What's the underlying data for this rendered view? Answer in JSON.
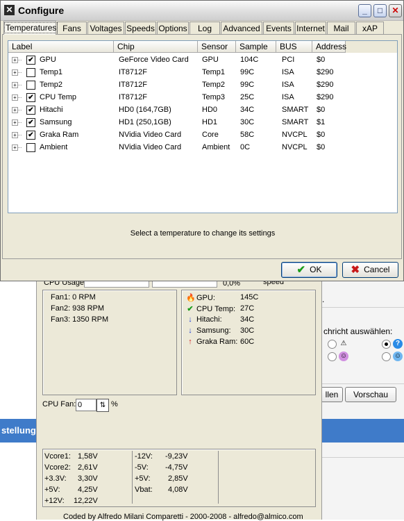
{
  "dialog": {
    "title": "Configure",
    "window_buttons": {
      "minimize": "_",
      "maximize": "□",
      "close": "✕"
    },
    "tabs": [
      {
        "label": "Temperatures",
        "active": true
      },
      {
        "label": "Fans"
      },
      {
        "label": "Voltages"
      },
      {
        "label": "Speeds"
      },
      {
        "label": "Options"
      },
      {
        "label": "Log"
      },
      {
        "label": "Advanced"
      },
      {
        "label": "Events"
      },
      {
        "label": "Internet"
      },
      {
        "label": "Mail"
      },
      {
        "label": "xAP"
      }
    ],
    "columns": [
      "Label",
      "Chip",
      "Sensor",
      "Sample",
      "BUS",
      "Address"
    ],
    "rows": [
      {
        "checked": true,
        "label": "GPU",
        "chip": "GeForce Video Card",
        "sensor": "GPU",
        "sample": "104C",
        "bus": "PCI",
        "address": "$0"
      },
      {
        "checked": false,
        "label": "Temp1",
        "chip": "IT8712F",
        "sensor": "Temp1",
        "sample": "99C",
        "bus": "ISA",
        "address": "$290"
      },
      {
        "checked": false,
        "label": "Temp2",
        "chip": "IT8712F",
        "sensor": "Temp2",
        "sample": "99C",
        "bus": "ISA",
        "address": "$290"
      },
      {
        "checked": true,
        "label": "CPU Temp",
        "chip": "IT8712F",
        "sensor": "Temp3",
        "sample": "25C",
        "bus": "ISA",
        "address": "$290"
      },
      {
        "checked": true,
        "label": "Hitachi",
        "chip": "HD0 (164,7GB)",
        "sensor": "HD0",
        "sample": "34C",
        "bus": "SMART",
        "address": "$0"
      },
      {
        "checked": true,
        "label": "Samsung",
        "chip": "HD1 (250,1GB)",
        "sensor": "HD1",
        "sample": "30C",
        "bus": "SMART",
        "address": "$1"
      },
      {
        "checked": true,
        "label": "Graka Ram",
        "chip": "NVidia Video Card",
        "sensor": "Core",
        "sample": "58C",
        "bus": "NVCPL",
        "address": "$0"
      },
      {
        "checked": false,
        "label": "Ambient",
        "chip": "NVidia Video Card",
        "sensor": "Ambient",
        "sample": "0C",
        "bus": "NVCPL",
        "address": "$0"
      }
    ],
    "hint": "Select a temperature to change its settings",
    "ok_label": "OK",
    "cancel_label": "Cancel"
  },
  "monitor": {
    "cpu_usage_label": "CPU Usage",
    "cpu_usage_value": "0,0%",
    "speed_label": "speed",
    "fans": [
      "Fan1: 0 RPM",
      "Fan2: 938 RPM",
      "Fan3: 1350 RPM"
    ],
    "temps": [
      {
        "icon": "fire-icon",
        "label": "GPU:",
        "value": "145C"
      },
      {
        "icon": "check-icon",
        "label": "CPU Temp:",
        "value": "27C"
      },
      {
        "icon": "arrow-down-icon",
        "label": "Hitachi:",
        "value": "34C"
      },
      {
        "icon": "arrow-down-icon",
        "label": "Samsung:",
        "value": "30C"
      },
      {
        "icon": "arrow-up-icon",
        "label": "Graka Ram:",
        "value": "60C"
      }
    ],
    "cpu_fan_label": "CPU Fan:",
    "cpu_fan_value": "0",
    "cpu_fan_unit": "%",
    "voltages_left": [
      {
        "label": "Vcore1:",
        "value": "1,58V"
      },
      {
        "label": "Vcore2:",
        "value": "2,61V"
      },
      {
        "label": "+3.3V:",
        "value": "3,30V"
      },
      {
        "label": "+5V:",
        "value": "4,25V"
      },
      {
        "label": "+12V:",
        "value": "12,22V"
      }
    ],
    "voltages_right": [
      {
        "label": "-12V:",
        "value": "-9,23V"
      },
      {
        "label": "-5V:",
        "value": "-4,75V"
      },
      {
        "label": "+5V:",
        "value": "2,85V"
      },
      {
        "label": "Vbat:",
        "value": "4,08V"
      }
    ],
    "credit": "Coded by Alfredo Milani Comparetti - 2000-2008 - alfredo@almico.com"
  },
  "background": {
    "message_select_text": "chricht auswählen:",
    "button_fillen": "llen",
    "button_preview": "Vorschau",
    "band_text": "stellung",
    "period_text": "."
  },
  "colors": {
    "titlebar": "#dfdfdf",
    "ok_icon": "#1a9c1a",
    "cancel_icon": "#c81818",
    "fire": "#e65c00",
    "check": "#1a9c1a",
    "arrow_down": "#1f3fd1",
    "arrow_up": "#d11f1f",
    "band": "#3f7bc9"
  }
}
